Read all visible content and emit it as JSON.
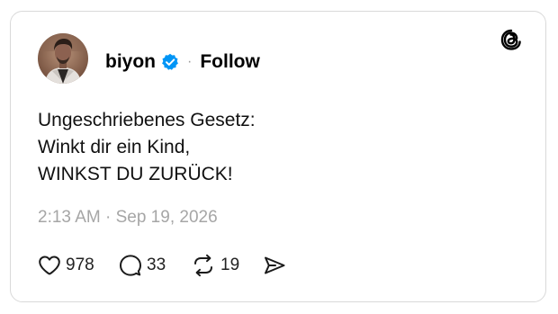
{
  "post": {
    "username": "biyon",
    "follow_label": "Follow",
    "separator": "·",
    "text_lines": [
      "Ungeschriebenes Gesetz:",
      "Winkt dir ein Kind,",
      "WINKST DU ZURÜCK!"
    ],
    "timestamp": "2:13 AM · Sep 19, 2026",
    "likes": "978",
    "comments": "33",
    "reposts": "19"
  },
  "icons": {
    "logo": "threads-logo-icon",
    "verified": "verified-badge-icon",
    "like": "heart-icon",
    "comment": "comment-bubble-icon",
    "repost": "repost-icon",
    "share": "send-icon"
  },
  "colors": {
    "verified_badge": "#0095f6",
    "timestamp": "#a6a6a6",
    "border": "#d9d9d9"
  }
}
